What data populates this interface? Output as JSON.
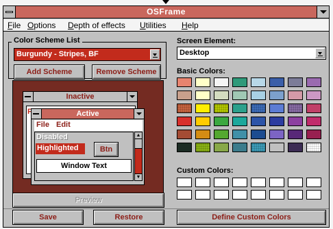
{
  "window": {
    "title": "OSFrame"
  },
  "menu": [
    "File",
    "Options",
    "Depth of effects",
    "Utilities",
    "Help"
  ],
  "scheme": {
    "list_label": "Color Scheme List",
    "selected": "Burgundy - Stripes, BF",
    "add_label": "Add Scheme",
    "remove_label": "Remove Scheme"
  },
  "element": {
    "label": "Screen Element:",
    "selected": "Desktop"
  },
  "basic_colors": {
    "label": "Basic Colors:",
    "rows": [
      [
        "#e8846f",
        "#ffffc8",
        "#f4f4f4",
        "#2f9a7a",
        "#b8d8e8",
        "#3a5ea8",
        "#7c7c98",
        "#9a6ab0"
      ],
      [
        "#c8a08c",
        "#ffffc8",
        "#d4dcc0",
        "#a0c8b4",
        "#a8d0e4",
        "#7ca0cc",
        "#d49aa8",
        "#cc98c4"
      ],
      [
        "#c86440",
        "#ffee00",
        "#b4c800",
        "#2ca08c",
        "#3c6cb8",
        "#5c7cd4",
        "#886ca4",
        "#c04068"
      ],
      [
        "#d8302c",
        "#ffcc00",
        "#3ca840",
        "#1ca89c",
        "#2c54a8",
        "#2c3ca0",
        "#8c40a0",
        "#c02c6c"
      ],
      [
        "#a44c34",
        "#d48c14",
        "#54a830",
        "#4090a8",
        "#1c4c90",
        "#7c64c4",
        "#582878",
        "#982050"
      ],
      [
        "#1c2c24",
        "#8cb414",
        "#88a848",
        "#3c7c8c",
        "#3c9cb8",
        "#c0c0c0",
        "#3c2c54",
        "#ffffff"
      ]
    ]
  },
  "custom_colors": {
    "label": "Custom Colors:"
  },
  "preview_windows": {
    "inactive_title": "Inactive",
    "active_title": "Active",
    "menu_file": "File",
    "menu_edit": "Edit",
    "disabled": "Disabled",
    "highlighted": "Highlighted",
    "button": "Btn",
    "window_text": "Window Text",
    "inactive_menu_letter": "Fi"
  },
  "buttons": {
    "preview": "Preview",
    "save": "Save",
    "restore": "Restore",
    "define_custom": "Define Custom Colors"
  },
  "colors": {
    "titlebar": "#c9675d",
    "accent_text": "#8c1e17",
    "scheme_combo": "#c22b1c",
    "preview_bg": "#742b22"
  }
}
